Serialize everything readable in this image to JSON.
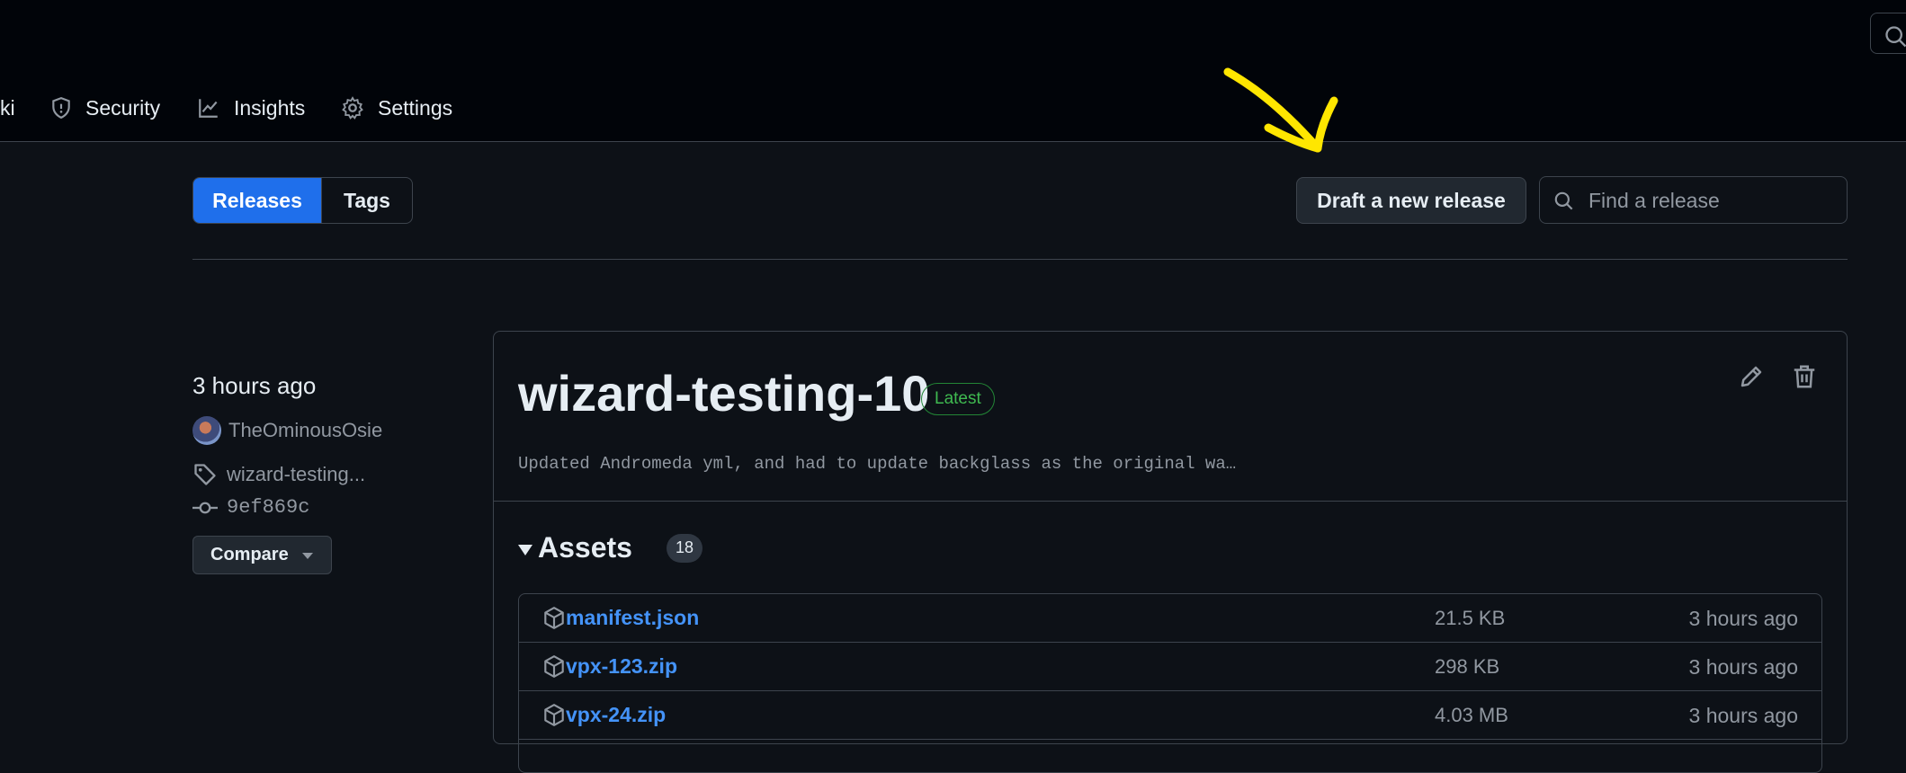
{
  "nav": {
    "items": [
      {
        "label": "ki",
        "icon": "book-icon"
      },
      {
        "label": "Security",
        "icon": "shield-icon"
      },
      {
        "label": "Insights",
        "icon": "graph-icon"
      },
      {
        "label": "Settings",
        "icon": "gear-icon"
      }
    ]
  },
  "toolbar": {
    "tabs": [
      {
        "label": "Releases",
        "active": true
      },
      {
        "label": "Tags",
        "active": false
      }
    ],
    "draft_label": "Draft a new release",
    "search_placeholder": "Find a release"
  },
  "release": {
    "time": "3 hours ago",
    "author": "TheOminousOsie",
    "tag": "wizard-testing...",
    "commit": "9ef869c",
    "compare_label": "Compare",
    "title": "wizard-testing-10",
    "badge": "Latest",
    "description": "Updated Andromeda yml, and had to update backglass as the original wa…",
    "assets_label": "Assets",
    "assets_count": "18",
    "assets": [
      {
        "name": "manifest.json",
        "size": "21.5 KB",
        "time": "3 hours ago"
      },
      {
        "name": "vpx-123.zip",
        "size": "298 KB",
        "time": "3 hours ago"
      },
      {
        "name": "vpx-24.zip",
        "size": "4.03 MB",
        "time": "3 hours ago"
      }
    ]
  },
  "colors": {
    "accent": "#1f6feb",
    "link": "#4493f8",
    "latest_badge": "#3fb950",
    "annotation_arrow": "#ffe600"
  }
}
